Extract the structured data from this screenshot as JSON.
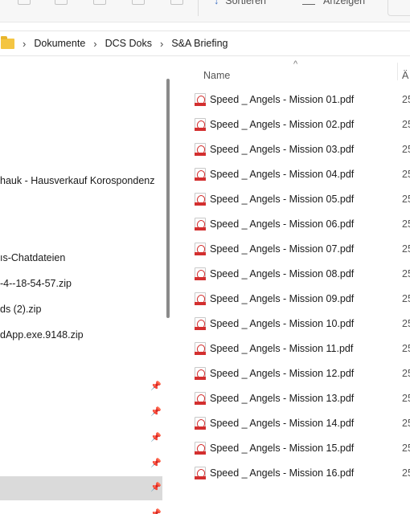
{
  "toolbar": {
    "sort_label": "Sortieren",
    "view_label": "Anzeigen",
    "sort_icon": "sort-arrow-icon",
    "view_icon": "view-lines-icon"
  },
  "breadcrumb": {
    "items": [
      "Dokumente",
      "DCS Doks",
      "S&A Briefing"
    ],
    "separator": "›"
  },
  "nav": {
    "items": [
      "hauk - Hausverkauf Korospondenz",
      "ıs-Chatdateien",
      "-4--18-54-57.zip",
      "ds (2).zip",
      "dApp.exe.9148.zip"
    ]
  },
  "filelist": {
    "col_name": "Name",
    "col_date": "Ä",
    "sort_caret": "^",
    "files": [
      {
        "name": "Speed _ Angels - Mission 01.pdf",
        "date": "25"
      },
      {
        "name": "Speed _ Angels - Mission 02.pdf",
        "date": "25"
      },
      {
        "name": "Speed _ Angels - Mission 03.pdf",
        "date": "25"
      },
      {
        "name": "Speed _ Angels - Mission 04.pdf",
        "date": "25"
      },
      {
        "name": "Speed _ Angels - Mission 05.pdf",
        "date": "25"
      },
      {
        "name": "Speed _ Angels - Mission 06.pdf",
        "date": "25"
      },
      {
        "name": "Speed _ Angels - Mission 07.pdf",
        "date": "25"
      },
      {
        "name": "Speed _ Angels - Mission 08.pdf",
        "date": "25"
      },
      {
        "name": "Speed _ Angels - Mission 09.pdf",
        "date": "25"
      },
      {
        "name": "Speed _ Angels - Mission 10.pdf",
        "date": "25"
      },
      {
        "name": "Speed _ Angels - Mission 11.pdf",
        "date": "25"
      },
      {
        "name": "Speed _ Angels - Mission 12.pdf",
        "date": "25"
      },
      {
        "name": "Speed _ Angels - Mission 13.pdf",
        "date": "25"
      },
      {
        "name": "Speed _ Angels - Mission 14.pdf",
        "date": "25"
      },
      {
        "name": "Speed _ Angels - Mission 15.pdf",
        "date": "25"
      },
      {
        "name": "Speed _ Angels - Mission 16.pdf",
        "date": "25"
      }
    ]
  },
  "colors": {
    "selection": "#dadada",
    "pdf_red": "#d32f2f",
    "folder_yellow": "#f4c542"
  }
}
